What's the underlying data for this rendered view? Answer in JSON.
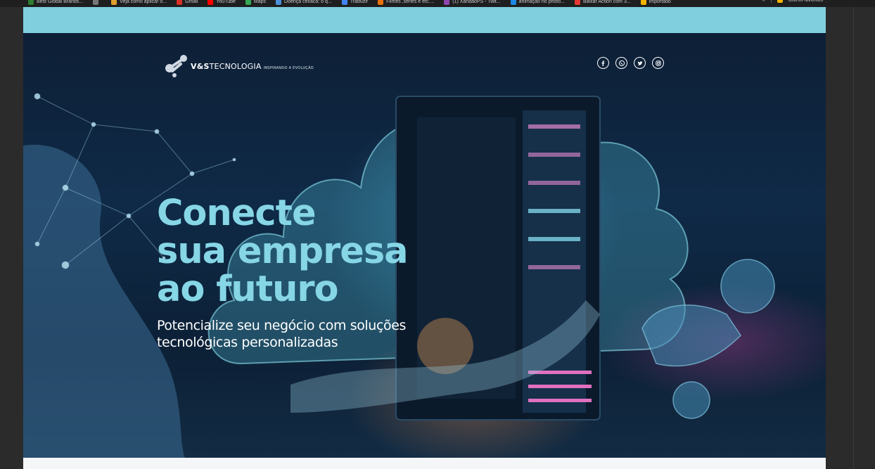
{
  "browser": {
    "bookmarks": [
      {
        "label": "Best Global Brands...",
        "color": "#2e7d32"
      },
      {
        "label": "",
        "color": "#777777"
      },
      {
        "label": "Veja como aplicar o...",
        "color": "#e0a030"
      },
      {
        "label": "Gmail",
        "color": "#d93025"
      },
      {
        "label": "YouTube",
        "color": "#ff0000"
      },
      {
        "label": "Maps",
        "color": "#34a853"
      },
      {
        "label": "Doença celíaca: o q...",
        "color": "#4a90d9"
      },
      {
        "label": "Traduzir",
        "color": "#4285f4"
      },
      {
        "label": "Filmes ,séries e etc....",
        "color": "#e8710a"
      },
      {
        "label": "(1) XandaoPS - Twit...",
        "color": "#8e44ad"
      },
      {
        "label": "animação no photo...",
        "color": "#1e88e5"
      },
      {
        "label": "Baixar Action com 3...",
        "color": "#e53935"
      },
      {
        "label": "importado",
        "color": "#f4b400"
      }
    ],
    "overflow": "»",
    "other_bookmarks": "Outros favoritos"
  },
  "header": {
    "brand_bold": "V&S",
    "brand_rest": "TECNOLOGIA",
    "tagline": "INSPIRANDO A EVOLUÇÃO",
    "social_icons": [
      "facebook-icon",
      "whatsapp-icon",
      "twitter-icon",
      "instagram-icon"
    ]
  },
  "hero": {
    "headline_lines": [
      "Conecte",
      "sua empresa",
      "ao futuro"
    ],
    "subline_lines": [
      "Potencialize seu negócio com soluções",
      "tecnológicas personalizadas"
    ]
  },
  "colors": {
    "topband": "#7fcfdf",
    "headline": "#86d6e6",
    "hero_bg": "#0f2a47"
  }
}
